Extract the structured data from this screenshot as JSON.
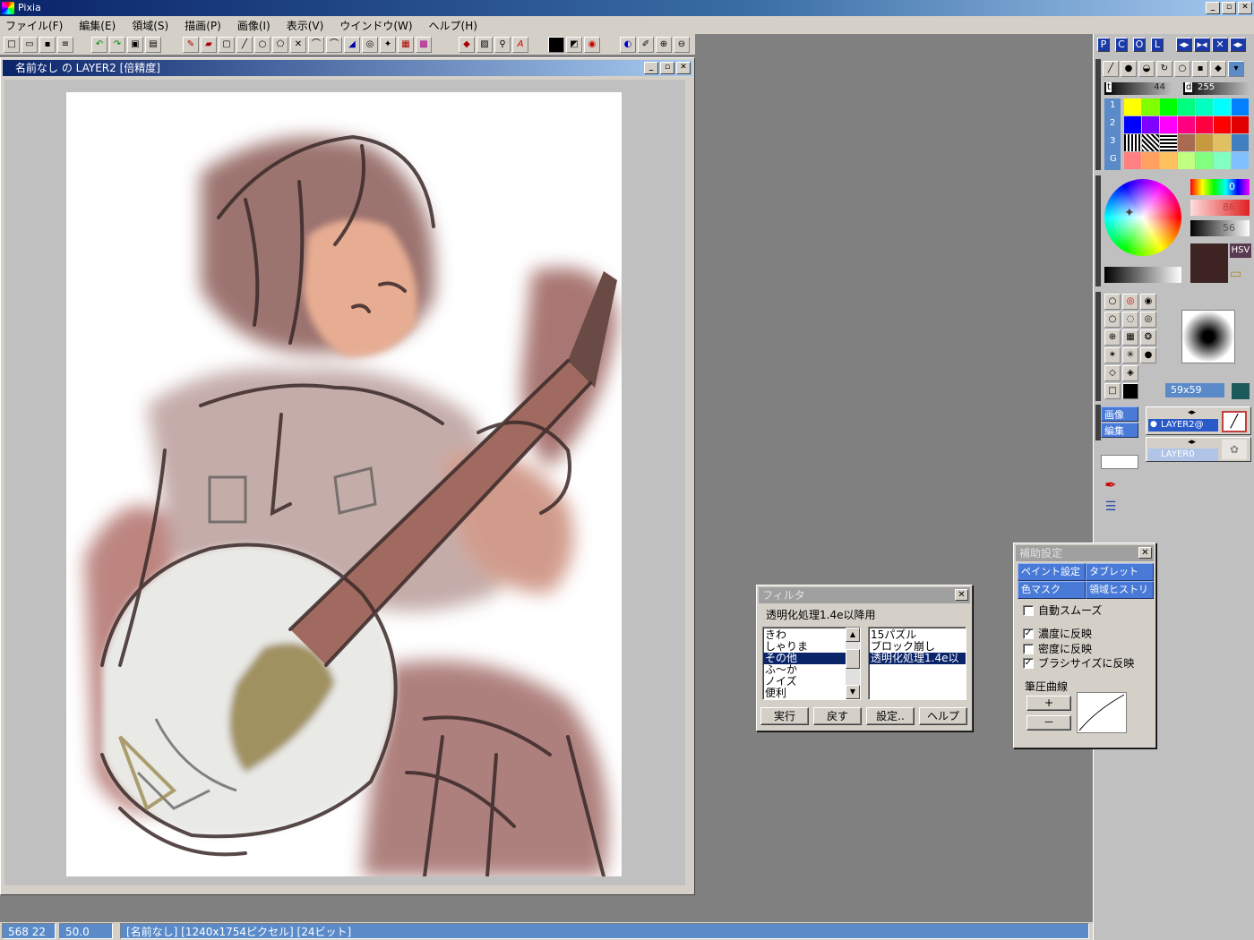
{
  "app": {
    "title": "Pixia",
    "min": "_",
    "max": "▫",
    "close": "✕"
  },
  "menu": [
    "ファイル(F)",
    "編集(E)",
    "領域(S)",
    "描画(P)",
    "画像(I)",
    "表示(V)",
    "ウインドウ(W)",
    "ヘルプ(H)"
  ],
  "document": {
    "title": "名前なし の LAYER2 [倍精度]"
  },
  "status": {
    "coords": "568 22",
    "zoom": "50.0",
    "info": "[名前なし] [1240x1754ピクセル] [24ビット]"
  },
  "panel": {
    "tabs": [
      "P",
      "C",
      "O",
      "L"
    ],
    "density_label": "t",
    "density_value": "44",
    "size_label": "d",
    "size_value": "255",
    "palette_rows": [
      "1",
      "2",
      "3",
      "G"
    ],
    "hue_value": "0",
    "sat_value": "86",
    "val_value": "56",
    "color_mode": "HSV",
    "brush_size": "59x59",
    "layer_menu": [
      "画像",
      "編集"
    ],
    "layers": [
      "LAYER2@",
      "LAYER0"
    ]
  },
  "filter_dialog": {
    "title": "フィルタ",
    "current": "透明化処理1.4e以降用",
    "categories": [
      "きわ",
      "しゃりま",
      "その他",
      "ふ～か",
      "ノイズ",
      "便利"
    ],
    "selected_category": 2,
    "filters": [
      "15パズル",
      "ブロック崩し",
      "透明化処理1.4e以"
    ],
    "selected_filter": 2,
    "buttons": [
      "実行",
      "戻す",
      "設定..",
      "ヘルプ"
    ]
  },
  "aux_dialog": {
    "title": "補助設定",
    "tabs": [
      "ペイント設定",
      "タブレット",
      "色マスク",
      "領域ヒストリ"
    ],
    "auto_smooth": "自動スムーズ",
    "density_reflect": "濃度に反映",
    "thickness_reflect": "密度に反映",
    "brushsize_reflect": "ブラシサイズに反映",
    "pressure_curve": "筆圧曲線",
    "plus": "+",
    "minus": "－",
    "checked": [
      false,
      true,
      false,
      true
    ]
  },
  "colors": {
    "titlebar": "#0a246a",
    "selection": "#0a246a",
    "current_color": "#3d2422"
  }
}
